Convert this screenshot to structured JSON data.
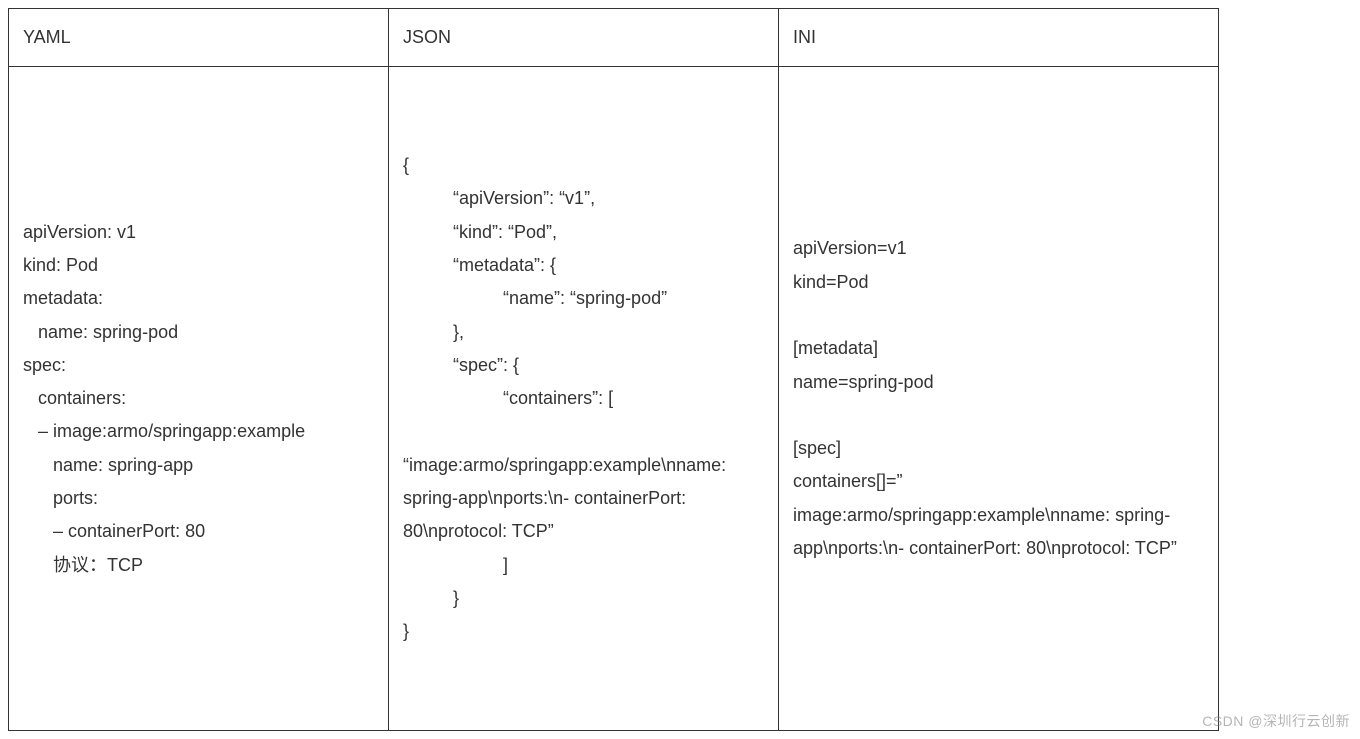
{
  "headers": {
    "yaml": "YAML",
    "json": "JSON",
    "ini": "INI"
  },
  "cells": {
    "yaml": "apiVersion: v1\nkind: Pod\nmetadata:\n   name: spring-pod\nspec:\n   containers:\n   – image:armo/springapp:example\n      name: spring-app\n      ports:\n      – containerPort: 80\n      协议：TCP",
    "json": "{\n          “apiVersion”: “v1”,\n          “kind”: “Pod”,\n          “metadata”: {\n                    “name”: “spring-pod”\n          },\n          “spec”: {\n                    “containers”: [\n                         “image:armo/springapp:example\\nname: spring-app\\nports:\\n- containerPort: 80\\nprotocol: TCP”\n                    ]\n          }\n}",
    "ini": "apiVersion=v1\nkind=Pod\n\n[metadata]\nname=spring-pod\n\n[spec]\ncontainers[]=” image:armo/springapp:example\\nname: spring-app\\nports:\\n- containerPort: 80\\nprotocol: TCP”"
  },
  "watermark": "CSDN @深圳行云创新"
}
